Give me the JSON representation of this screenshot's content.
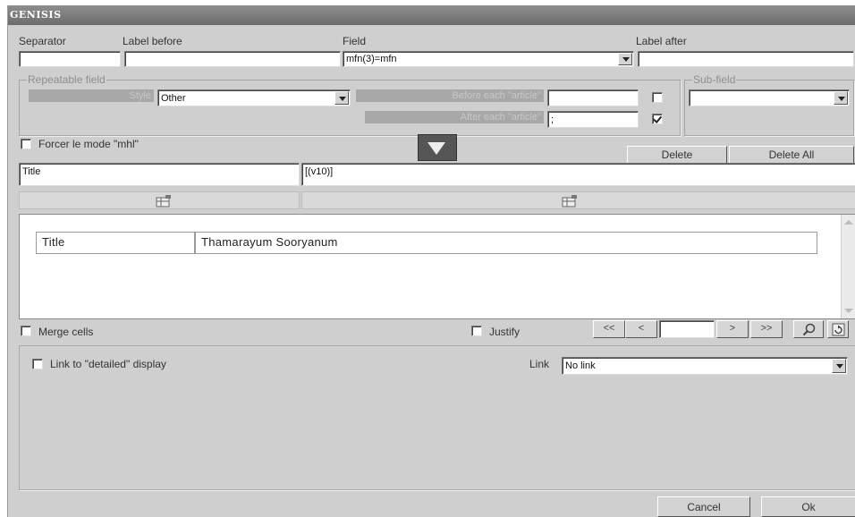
{
  "window": {
    "title": "GENISIS"
  },
  "top": {
    "separator_label": "Separator",
    "label_before_label": "Label before",
    "field_label": "Field",
    "label_after_label": "Label after",
    "separator_value": "",
    "label_before_value": "",
    "field_value": "mfn(3)=mfn",
    "label_after_value": ""
  },
  "repeatable": {
    "title": "Repeatable field",
    "style_label": "Style",
    "style_value": "Other",
    "before_label": "Before each \"article\"",
    "before_value": "",
    "before_checked": false,
    "after_label": "After each \"article\"",
    "after_value": ";",
    "after_checked": true
  },
  "subfield": {
    "title": "Sub-field",
    "value": ""
  },
  "force_mode": {
    "label": "Forcer le mode \"mhl\"",
    "checked": false
  },
  "actions": {
    "delete": "Delete",
    "delete_all": "Delete All"
  },
  "entry": {
    "label_value": "Title",
    "format_value": "[(v10)]"
  },
  "preview": {
    "rows": [
      {
        "label": "Title",
        "value": "Thamarayum Sooryanum"
      }
    ]
  },
  "options": {
    "merge_cells": "Merge cells",
    "justify": "Justify",
    "nav_first": "<<",
    "nav_prev": "<",
    "nav_page": "",
    "nav_next": ">",
    "nav_last": ">>"
  },
  "link": {
    "detailed_label": "Link to \"detailed\" display",
    "link_label": "Link",
    "link_value": "No link"
  },
  "footer": {
    "cancel": "Cancel",
    "ok": "Ok"
  },
  "icons": {
    "dropdown": "chevron-down-icon",
    "move_down": "triangle-down-icon",
    "column": "table-column-icon",
    "search": "magnifier-icon",
    "refresh": "refresh-icon"
  }
}
